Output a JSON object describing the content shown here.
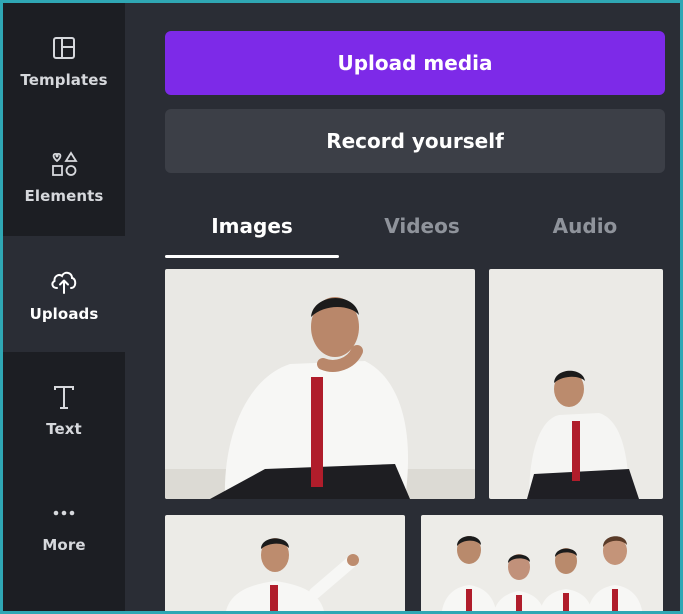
{
  "sidebar": {
    "items": [
      {
        "label": "Templates",
        "icon": "templates-icon"
      },
      {
        "label": "Elements",
        "icon": "elements-icon"
      },
      {
        "label": "Uploads",
        "icon": "upload-cloud-icon",
        "active": true
      },
      {
        "label": "Text",
        "icon": "text-icon"
      },
      {
        "label": "More",
        "icon": "more-dots-icon"
      }
    ]
  },
  "uploads": {
    "upload_button": "Upload media",
    "record_button": "Record yourself",
    "tabs": [
      {
        "label": "Images",
        "active": true
      },
      {
        "label": "Videos"
      },
      {
        "label": "Audio"
      }
    ],
    "images": [
      {
        "subject": "man in white shirt and red tie, crouching pose"
      },
      {
        "subject": "man in white shirt and red tie, seated pose"
      },
      {
        "subject": "man pointing upward, white shirt and red tie"
      },
      {
        "subject": "group of four men in white shirts and red ties"
      }
    ]
  },
  "colors": {
    "accent_purple": "#7d2ae8",
    "frame_border": "#2fa7b4",
    "panel_bg": "#2a2d35",
    "rail_bg": "#1c1e23"
  }
}
